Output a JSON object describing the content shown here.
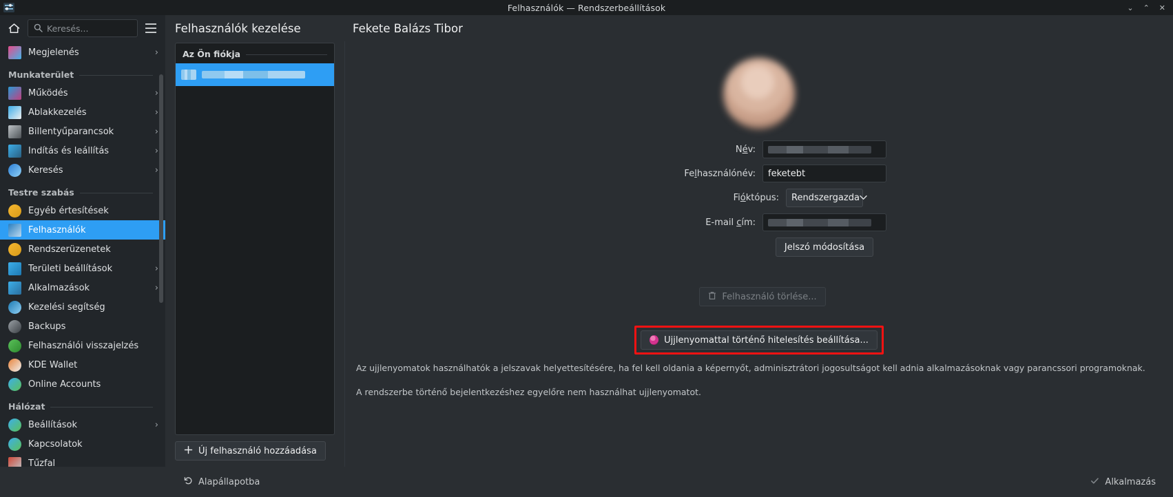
{
  "window": {
    "title": "Felhasználók — Rendszerbeállítások",
    "app_icon": "settings-sliders-icon",
    "controls": {
      "minimize": "⌄",
      "maximize": "⌃",
      "close": "✕"
    }
  },
  "sidebar": {
    "home_icon": "home-icon",
    "menu_icon": "hamburger-menu-icon",
    "search": {
      "placeholder": "Keresés...",
      "value": "",
      "icon": "search-icon"
    },
    "entries": [
      {
        "type": "item",
        "label": "Megjelenés",
        "icon": "appearance-icon",
        "arrow": "›",
        "selected": false,
        "color1": "#e84c8a",
        "color2": "#44b3e8"
      },
      {
        "type": "group",
        "label": "Munkaterület"
      },
      {
        "type": "item",
        "label": "Működés",
        "icon": "workspace-behavior-icon",
        "arrow": "›",
        "selected": false,
        "color1": "#2c9ad6",
        "color2": "#c0407f"
      },
      {
        "type": "item",
        "label": "Ablakkezelés",
        "icon": "window-management-icon",
        "arrow": "›",
        "selected": false,
        "color1": "#3daee9",
        "color2": "#eff0f1"
      },
      {
        "type": "item",
        "label": "Billentyűparancsok",
        "icon": "keyboard-shortcuts-icon",
        "arrow": "›",
        "selected": false,
        "color1": "#bdc3c7",
        "color2": "#4d5256"
      },
      {
        "type": "item",
        "label": "Indítás és leállítás",
        "icon": "startup-shutdown-icon",
        "arrow": "›",
        "selected": false,
        "color1": "#3daee9",
        "color2": "#2a5f80"
      },
      {
        "type": "item",
        "label": "Keresés",
        "icon": "search-module-icon",
        "arrow": "›",
        "selected": false,
        "color1": "#2c7fd6",
        "color2": "#8fd0f5"
      },
      {
        "type": "group",
        "label": "Testre szabás"
      },
      {
        "type": "item",
        "label": "Egyéb értesítések",
        "icon": "bell-notifications-icon",
        "arrow": "",
        "selected": false,
        "color1": "#f5b731",
        "color2": "#d89b18"
      },
      {
        "type": "item",
        "label": "Felhasználók",
        "icon": "users-icon",
        "arrow": "",
        "selected": true,
        "color1": "#2a7fc0",
        "color2": "#bcd9ef"
      },
      {
        "type": "item",
        "label": "Rendszerüzenetek",
        "icon": "bell-notifications-icon",
        "arrow": "",
        "selected": false,
        "color1": "#f5b731",
        "color2": "#d89b18"
      },
      {
        "type": "item",
        "label": "Területi beállítások",
        "icon": "regional-settings-icon",
        "arrow": "›",
        "selected": false,
        "color1": "#3daee9",
        "color2": "#1d7ab3"
      },
      {
        "type": "item",
        "label": "Alkalmazások",
        "icon": "applications-grid-icon",
        "arrow": "›",
        "selected": false,
        "color1": "#3daee9",
        "color2": "#2a6f9e"
      },
      {
        "type": "item",
        "label": "Kezelési segítség",
        "icon": "accessibility-icon",
        "arrow": "",
        "selected": false,
        "color1": "#1d7ab3",
        "color2": "#8fd0f5"
      },
      {
        "type": "item",
        "label": "Backups",
        "icon": "backups-clock-icon",
        "arrow": "",
        "selected": false,
        "color1": "#9aa0a5",
        "color2": "#3c4146"
      },
      {
        "type": "item",
        "label": "Felhasználói visszajelzés",
        "icon": "user-feedback-icon",
        "arrow": "",
        "selected": false,
        "color1": "#5ac15a",
        "color2": "#2e8b2e"
      },
      {
        "type": "item",
        "label": "KDE Wallet",
        "icon": "kde-wallet-icon",
        "arrow": "",
        "selected": false,
        "color1": "#e8833a",
        "color2": "#f0f0f0"
      },
      {
        "type": "item",
        "label": "Online Accounts",
        "icon": "online-accounts-icon",
        "arrow": "",
        "selected": false,
        "color1": "#3daee9",
        "color2": "#5ac15a"
      },
      {
        "type": "group",
        "label": "Hálózat"
      },
      {
        "type": "item",
        "label": "Beállítások",
        "icon": "network-settings-icon",
        "arrow": "›",
        "selected": false,
        "color1": "#3daee9",
        "color2": "#5ac15a"
      },
      {
        "type": "item",
        "label": "Kapcsolatok",
        "icon": "network-connections-icon",
        "arrow": "",
        "selected": false,
        "color1": "#3daee9",
        "color2": "#5ac15a"
      },
      {
        "type": "item",
        "label": "Tűzfal",
        "icon": "firewall-icon",
        "arrow": "",
        "selected": false,
        "color1": "#d04a3a",
        "color2": "#bdc3c7"
      }
    ]
  },
  "users_column": {
    "header": "Felhasználók kezelése",
    "list_group_label": "Az Ön fiókja",
    "selected_user_redacted": true,
    "add_user_button": {
      "label": "Új felhasználó hozzáadása",
      "icon": "plus-icon"
    }
  },
  "detail": {
    "header": "Fekete Balázs Tibor",
    "avatar": "user-avatar",
    "fields": [
      {
        "name": "name",
        "label_pre": "N",
        "label_accel": "é",
        "label_post": "v:",
        "value": "",
        "redacted": true,
        "type": "text"
      },
      {
        "name": "username",
        "label_pre": "Fe",
        "label_accel": "l",
        "label_post": "használónév:",
        "value": "feketebt",
        "redacted": false,
        "type": "text"
      },
      {
        "name": "account_type",
        "label_pre": "Fi",
        "label_accel": "ó",
        "label_post": "któpus:",
        "value": "Rendszergazda",
        "redacted": false,
        "type": "select"
      },
      {
        "name": "email",
        "label_pre": "E-mail ",
        "label_accel": "c",
        "label_post": "ím:",
        "value": "",
        "redacted": true,
        "type": "text"
      }
    ],
    "change_password_button": "Jelszó módosítása",
    "delete_user_button": {
      "label": "Felhasználó törlése...",
      "icon": "trash-icon",
      "disabled": true
    },
    "fingerprint_button": {
      "label": "Ujjlenyomattal történő hitelesítés beállítása...",
      "icon": "fingerprint-icon",
      "highlighted": true,
      "highlight_color": "#f41212"
    },
    "description_line_1": "Az ujjlenyomatok használhatók a jelszavak helyettesítésére, ha fel kell oldania a képernyőt, adminisztrátori jogosultságot kell adnia alkalmazásoknak vagy parancssori programoknak.",
    "description_line_2": "A rendszerbe történő bejelentkezéshez egyelőre nem használhat ujjlenyomatot."
  },
  "bottom_bar": {
    "reset_button": {
      "label": "Alapállapotba",
      "icon": "undo-icon"
    },
    "apply_button": {
      "label": "Alkalmazás",
      "icon": "check-icon",
      "disabled": true
    }
  }
}
